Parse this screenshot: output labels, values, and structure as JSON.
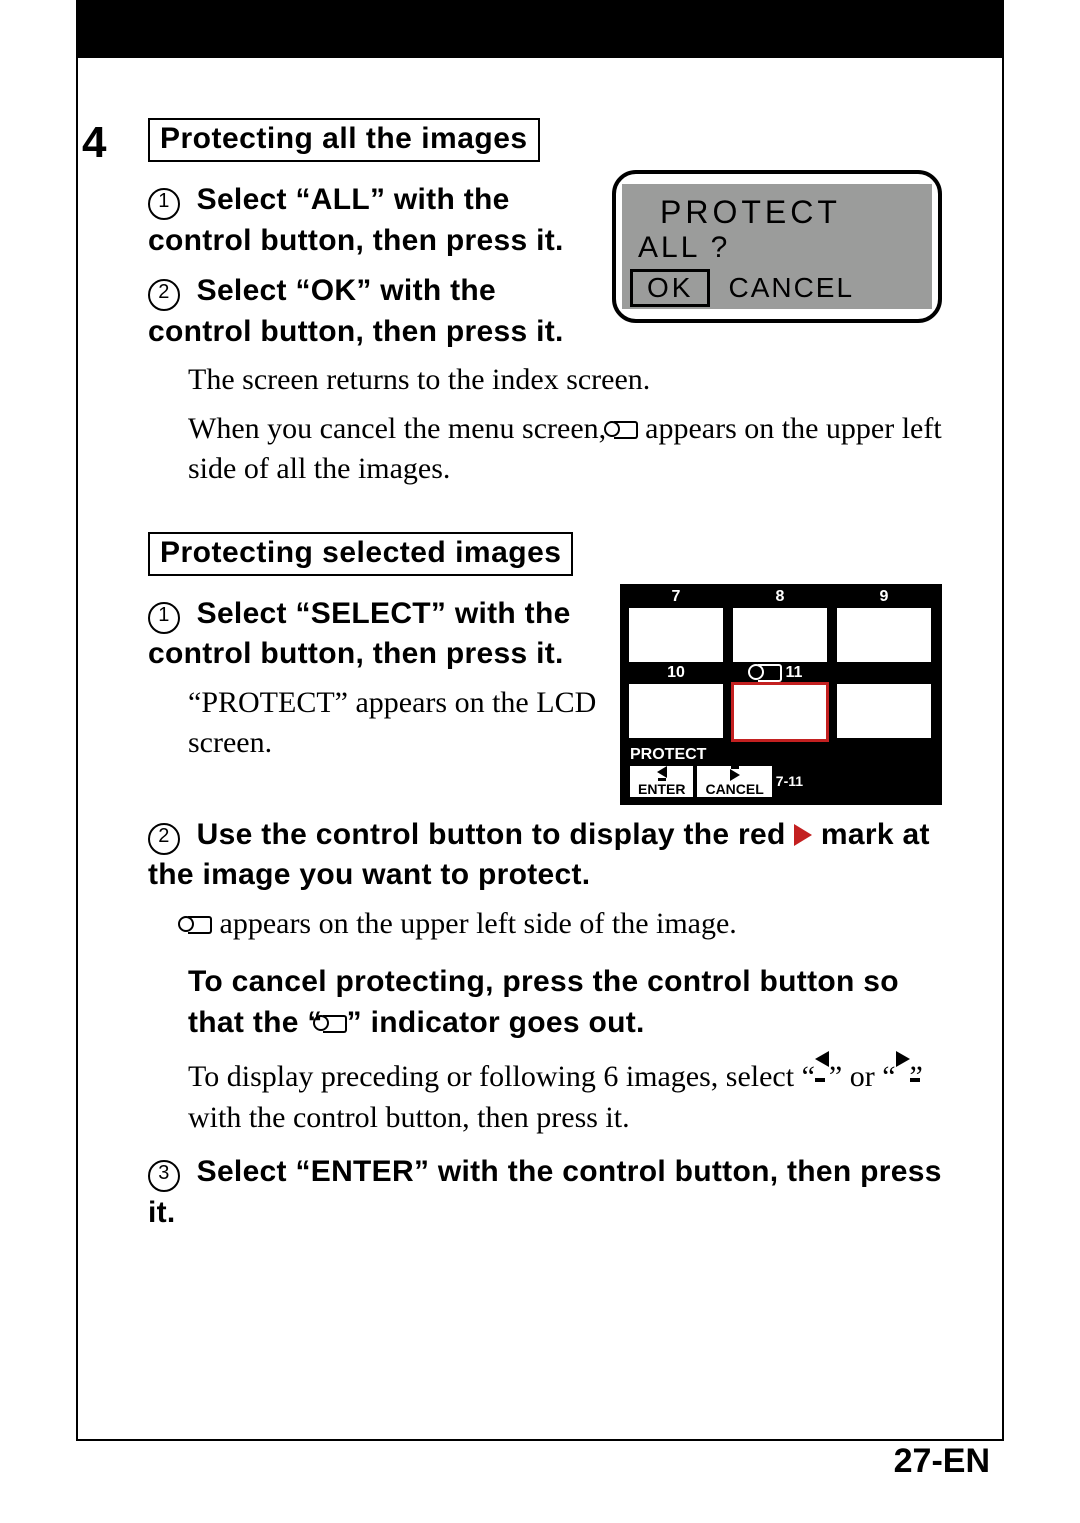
{
  "step_number": "4",
  "section_a": {
    "title": "Protecting all the images",
    "step1": "Select “ALL” with the control button, then press it.",
    "step2": "Select “OK” with the control button, then press it.",
    "result1": "The screen returns to the index screen.",
    "result2a": "When you cancel the menu screen, ",
    "result2b": " appears on the upper left side of all the images.",
    "lcd": {
      "line1": "PROTECT",
      "line2": "ALL ?",
      "ok": "OK",
      "cancel": "CANCEL"
    }
  },
  "section_b": {
    "title": "Protecting selected images",
    "step1": "Select “SELECT” with the control button, then press it.",
    "step1_result": "“PROTECT” appears on the LCD screen.",
    "step2a": "Use the control button to display the red ",
    "step2b": " mark at the image you want to protect.",
    "step2_resulta": "",
    "step2_resultb": " appears on the upper left side of the image.",
    "cancel_a": "To cancel protecting, press the control button so that the “",
    "cancel_b": "” indicator goes out.",
    "nav_a": "To display preceding or following 6 images, select “",
    "nav_b": "” or “",
    "nav_c": "” with the control button, then press it.",
    "step3": "Select “ENTER” with the control button, then press it.",
    "grid": {
      "nums": [
        "7",
        "8",
        "9",
        "10",
        "11"
      ],
      "label": "PROTECT",
      "enter": "ENTER",
      "cancel": "CANCEL",
      "range": "7-11"
    }
  },
  "page_number": "27-EN"
}
